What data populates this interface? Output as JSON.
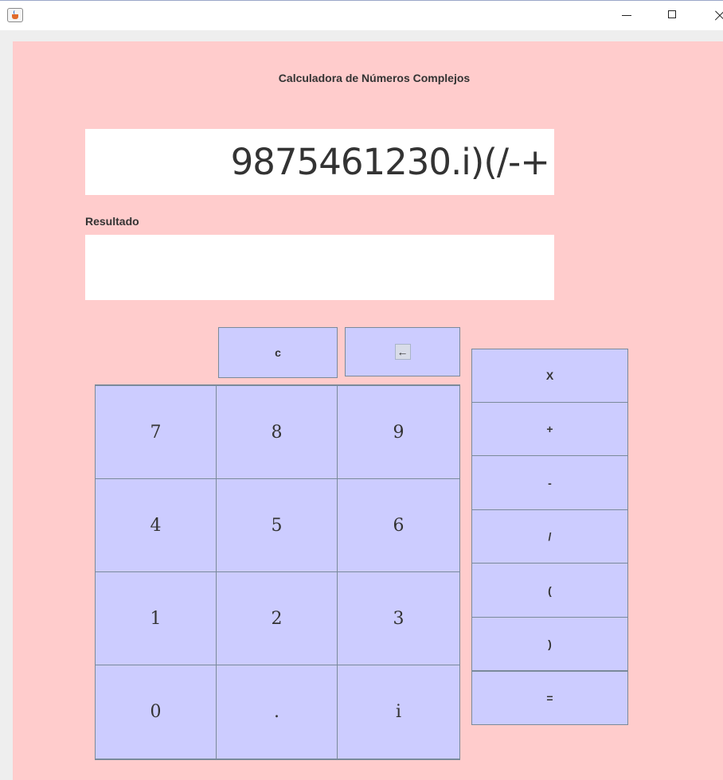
{
  "window": {
    "controls": [
      "minimize-icon",
      "maximize-icon",
      "close-icon"
    ]
  },
  "app": {
    "heading": "Calculadora de Números Complejos",
    "display_value": "9875461230.i)(/-+",
    "result_label": "Resultado",
    "result_value": ""
  },
  "buttons": {
    "clear": "c",
    "backspace": "←",
    "digits": [
      [
        "7",
        "8",
        "9"
      ],
      [
        "4",
        "5",
        "6"
      ],
      [
        "1",
        "2",
        "3"
      ],
      [
        "0",
        ".",
        "i"
      ]
    ],
    "operators": [
      "X",
      "+",
      "-",
      "/",
      "(",
      ")",
      "="
    ]
  },
  "colors": {
    "panel_background": "#ffcccc",
    "button_background": "#ccccff",
    "text": "#333333"
  }
}
